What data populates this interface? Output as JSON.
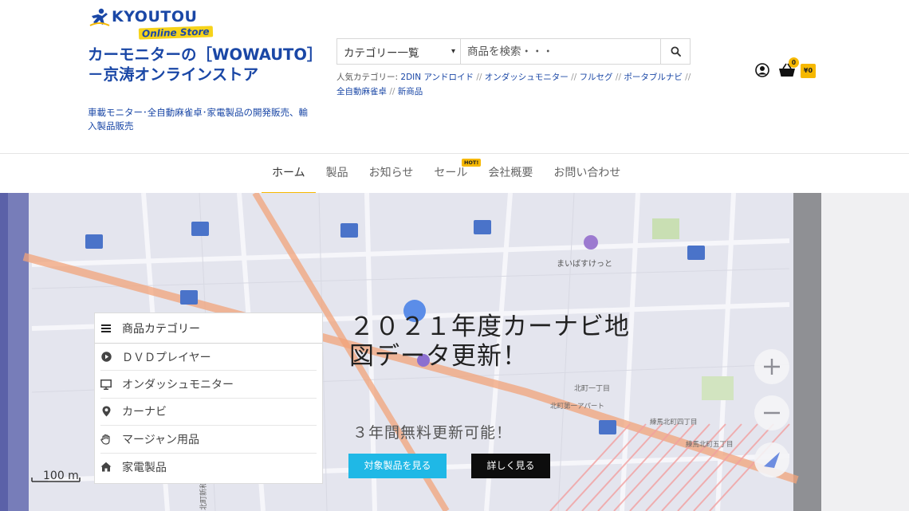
{
  "logo": {
    "brand": "KYOUTOU",
    "sub": "Online Store"
  },
  "site": {
    "title": "カーモニターの［WOWAUTO］－京涛オンラインストア",
    "tagline": "車載モニター･全自動麻雀卓･家電製品の開発販売、輸入製品販売"
  },
  "search": {
    "category_label": "カテゴリー一覧",
    "placeholder": "商品を検索・・・"
  },
  "popular": {
    "label": "人気カテゴリー:",
    "items": [
      "2DIN アンドロイド",
      "オンダッシュモニター",
      "フルセグ",
      "ポータブルナビ",
      "全自動麻雀卓",
      "新商品"
    ]
  },
  "cart": {
    "count": "0",
    "total": "¥0"
  },
  "nav": {
    "items": [
      "ホーム",
      "製品",
      "お知らせ",
      "セール",
      "会社概要",
      "お問い合わせ"
    ],
    "hot_badge": "HOT!"
  },
  "category_menu": {
    "title": "商品カテゴリー",
    "items": [
      {
        "label": "ＤＶＤプレイヤー",
        "icon": "play-circle-icon"
      },
      {
        "label": "オンダッシュモニター",
        "icon": "monitor-icon"
      },
      {
        "label": "カーナビ",
        "icon": "map-pin-icon"
      },
      {
        "label": "マージャン用品",
        "icon": "hand-icon"
      },
      {
        "label": "家電製品",
        "icon": "home-icon"
      }
    ]
  },
  "hero": {
    "title": "２０２１年度カーナビ地図データ更新！",
    "subtitle": "３年間無料更新可能！",
    "btn_primary": "対象製品を見る",
    "btn_secondary": "詳しく見る",
    "map_labels": [
      "まいばすけっと",
      "北町新和会館",
      "北町一丁目",
      "北町第一アパート",
      "練馬北町四丁目",
      "練馬北町五丁目"
    ],
    "scale_label": "100 m",
    "colors": {
      "accent": "#f6b800",
      "primary_button": "#1fb8e6",
      "link": "#1a47a6"
    }
  }
}
